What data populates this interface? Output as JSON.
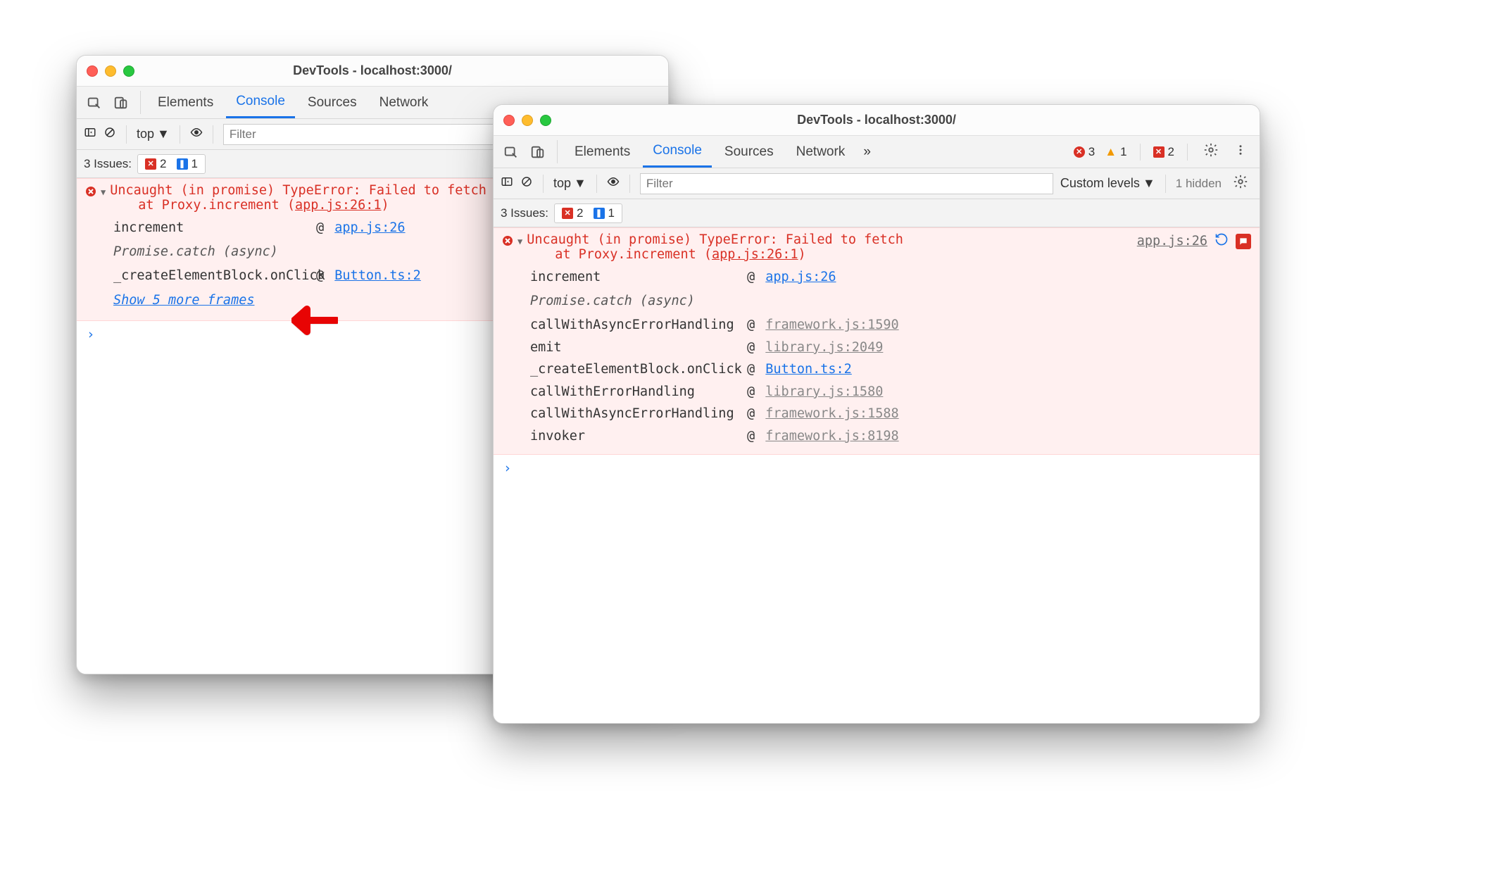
{
  "window_title": "DevTools - localhost:3000/",
  "tabs": {
    "elements": "Elements",
    "console": "Console",
    "sources": "Sources",
    "network": "Network"
  },
  "toolbar": {
    "context": "top",
    "filter_placeholder": "Filter",
    "levels_label": "Custom levels",
    "hidden_label": "1 hidden"
  },
  "issues": {
    "label": "3 Issues:",
    "err_count": "2",
    "info_count": "1"
  },
  "right_badges": {
    "errors": "3",
    "warnings": "1",
    "violations": "2"
  },
  "error": {
    "message": "Uncaught (in promise) TypeError: Failed to fetch",
    "at_line": "at Proxy.increment (",
    "at_loc": "app.js:26:1",
    "at_close": ")",
    "source_link": "app.js:26",
    "async_label": "Promise.catch (async)"
  },
  "stack_collapsed": [
    {
      "fn": "increment",
      "loc": "app.js:26",
      "class": "blue"
    },
    {
      "fn": "_createElementBlock.onClick",
      "loc": "Button.ts:2",
      "class": "blue"
    }
  ],
  "show_more": "Show 5 more frames",
  "stack_expanded": [
    {
      "fn": "increment",
      "loc": "app.js:26",
      "class": "blue"
    },
    {
      "fn": "callWithAsyncErrorHandling",
      "loc": "framework.js:1590",
      "class": "gray"
    },
    {
      "fn": "emit",
      "loc": "library.js:2049",
      "class": "gray"
    },
    {
      "fn": "_createElementBlock.onClick",
      "loc": "Button.ts:2",
      "class": "blue"
    },
    {
      "fn": "callWithErrorHandling",
      "loc": "library.js:1580",
      "class": "gray"
    },
    {
      "fn": "callWithAsyncErrorHandling",
      "loc": "framework.js:1588",
      "class": "gray"
    },
    {
      "fn": "invoker",
      "loc": "framework.js:8198",
      "class": "gray"
    }
  ]
}
